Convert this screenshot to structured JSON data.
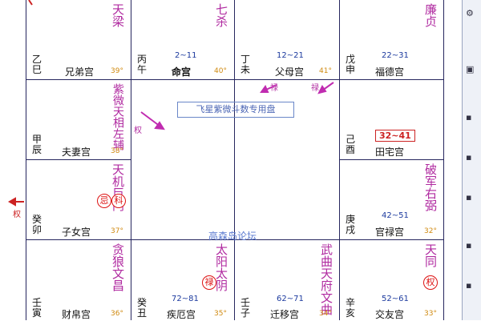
{
  "center": {
    "title": "飞星紫微斗数专用盘",
    "forum": "高森岛论坛"
  },
  "palaces": {
    "siblings": {
      "stem": "乙巳",
      "name": "兄弟宫",
      "age": "39",
      "stars": [
        "天梁"
      ]
    },
    "life": {
      "stem": "丙午",
      "name": "命宫",
      "range": "2~11",
      "age": "40",
      "stars": [
        "七杀"
      ]
    },
    "parents": {
      "stem": "丁未",
      "name": "父母宫",
      "range": "12~21",
      "age": "41",
      "stars": []
    },
    "fortune": {
      "stem": "戊申",
      "name": "福德宫",
      "range": "22~31",
      "stars": [
        "廉贞"
      ]
    },
    "spouse": {
      "stem": "甲辰",
      "name": "夫妻宫",
      "age": "38",
      "stars": [
        "左辅",
        "天相",
        "紫微"
      ]
    },
    "property": {
      "stem": "己酉",
      "name": "田宅宫",
      "range": "32~41",
      "stars": []
    },
    "children": {
      "stem": "癸卯",
      "name": "子女宫",
      "age": "37",
      "stars": [
        "巨门",
        "天机"
      ]
    },
    "career": {
      "stem": "庚戌",
      "name": "官禄宫",
      "range": "42~51",
      "age": "32",
      "stars": [
        "右弼",
        "破军"
      ]
    },
    "wealth": {
      "stem": "壬寅",
      "name": "财帛宫",
      "age": "36",
      "stars": [
        "文昌",
        "贪狼"
      ]
    },
    "health": {
      "stem": "癸丑",
      "name": "疾厄宫",
      "range": "72~81",
      "age": "35",
      "stars": [
        "太阴",
        "太阳"
      ]
    },
    "travel": {
      "stem": "壬子",
      "name": "迁移宫",
      "range": "62~71",
      "age": "34",
      "stars": [
        "文曲",
        "天府",
        "武曲"
      ]
    },
    "friends": {
      "stem": "辛亥",
      "name": "交友宫",
      "range": "52~61",
      "age": "33",
      "stars": [
        "天同"
      ]
    }
  },
  "transforms": {
    "lu_parents_left": "禄",
    "lu_parents_right": "禄",
    "quan_center": "权",
    "quan_left_edge": "权",
    "ji_children": "忌",
    "ke_children": "科",
    "lu_health": "禄",
    "quan_friends": "权"
  },
  "colors": {
    "star": "#b02aa0",
    "grid": "#26265e",
    "range": "#1c3a9e",
    "age": "#d08a10",
    "highlight": "#c22"
  }
}
